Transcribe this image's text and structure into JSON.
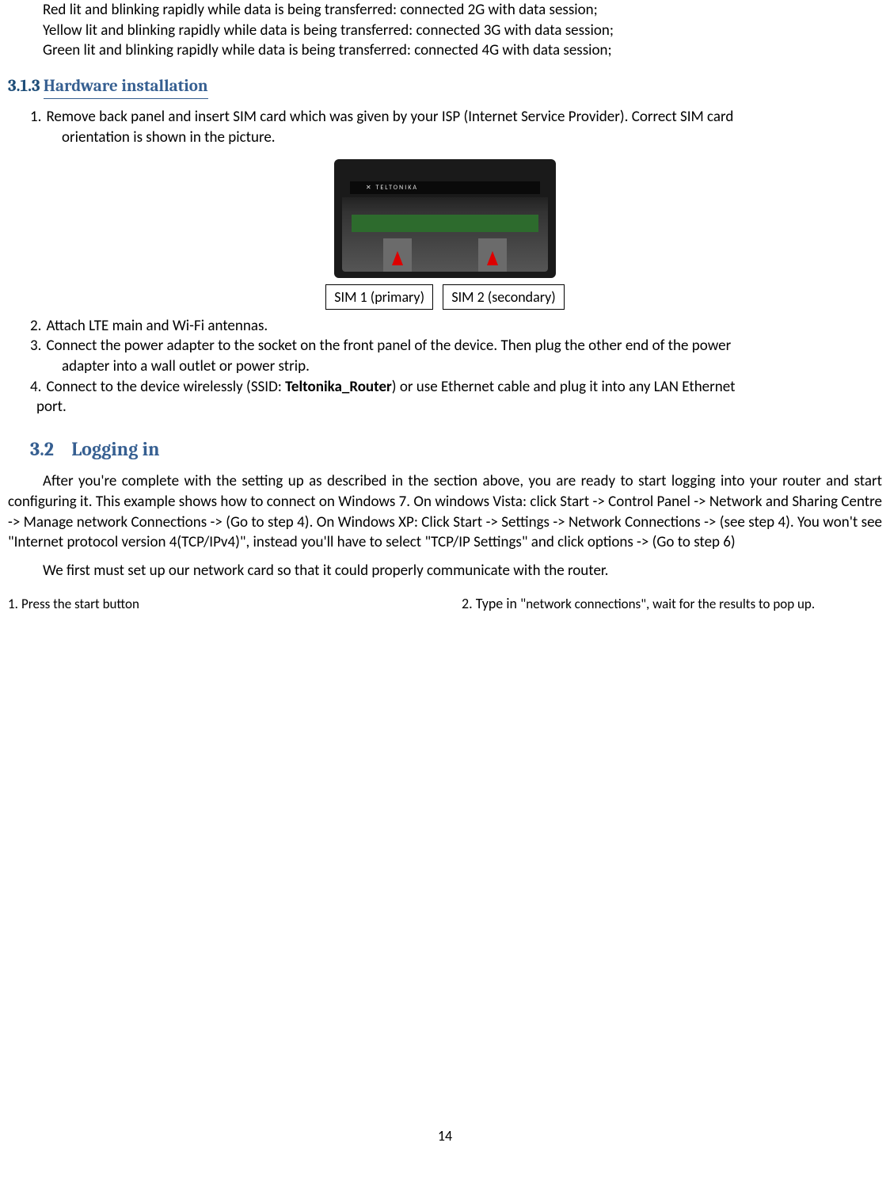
{
  "bullets_top": {
    "b1": "Red lit and blinking rapidly while data is being transferred: connected 2G with data session;",
    "b2": "Yellow lit and blinking rapidly while data is being transferred: connected 3G with data session;",
    "b3": "Green lit and blinking rapidly while data is being transferred: connected 4G with data session;"
  },
  "section_3_1_3": {
    "number": "3.1.3",
    "title": "Hardware installation"
  },
  "steps_313": {
    "s1n": "1.",
    "s1a": "Remove back panel and insert SIM card which was given by your ISP (Internet Service Provider). Correct SIM card",
    "s1b": "orientation is shown in the picture.",
    "s2n": "2. ",
    "s2": "Attach LTE main and Wi-Fi antennas.",
    "s3n": "3. ",
    "s3a": "Connect the power adapter to the socket on the front panel of the device. Then plug the other end of the power",
    "s3b": "adapter into a wall outlet or power strip.",
    "s4n": "4.",
    "s4a_pre": "Connect to the device wirelessly (SSID: ",
    "s4a_bold": "Teltonika_Router",
    "s4a_post": ") or use Ethernet cable and plug it into any LAN Ethernet",
    "s4b": "port."
  },
  "figure": {
    "brand": "✕ TELTONIKA",
    "sim1": "SIM 1 (primary)",
    "sim2": "SIM 2 (secondary)"
  },
  "section_3_2": {
    "number": "3.2",
    "title": "Logging in"
  },
  "para32": {
    "p1": "After you're complete with the setting up as described in the section above, you are ready to start logging into your router and start configuring it. This example shows how to connect on Windows 7. On windows Vista: click Start -> Control Panel -> Network and Sharing Centre -> Manage network Connections -> (Go to step 4). On Windows XP: Click Start -> Settings -> Network Connections -> (see step 4). You won't see \"Internet protocol version 4(TCP/IPv4)\", instead you'll have to select \"TCP/IP Settings\" and click options -> (Go to step 6)",
    "p2": "We first must set up our network card so that it could properly communicate with the router."
  },
  "cols": {
    "c1_n": "1.",
    "c1_t": "Press the start button",
    "c2_n": "2.",
    "c2_pre": "Type  in  \"",
    "c2_mid": "network  connections",
    "c2_post": "\",  wait  for  the  results  to pop up."
  },
  "page_number": "14"
}
